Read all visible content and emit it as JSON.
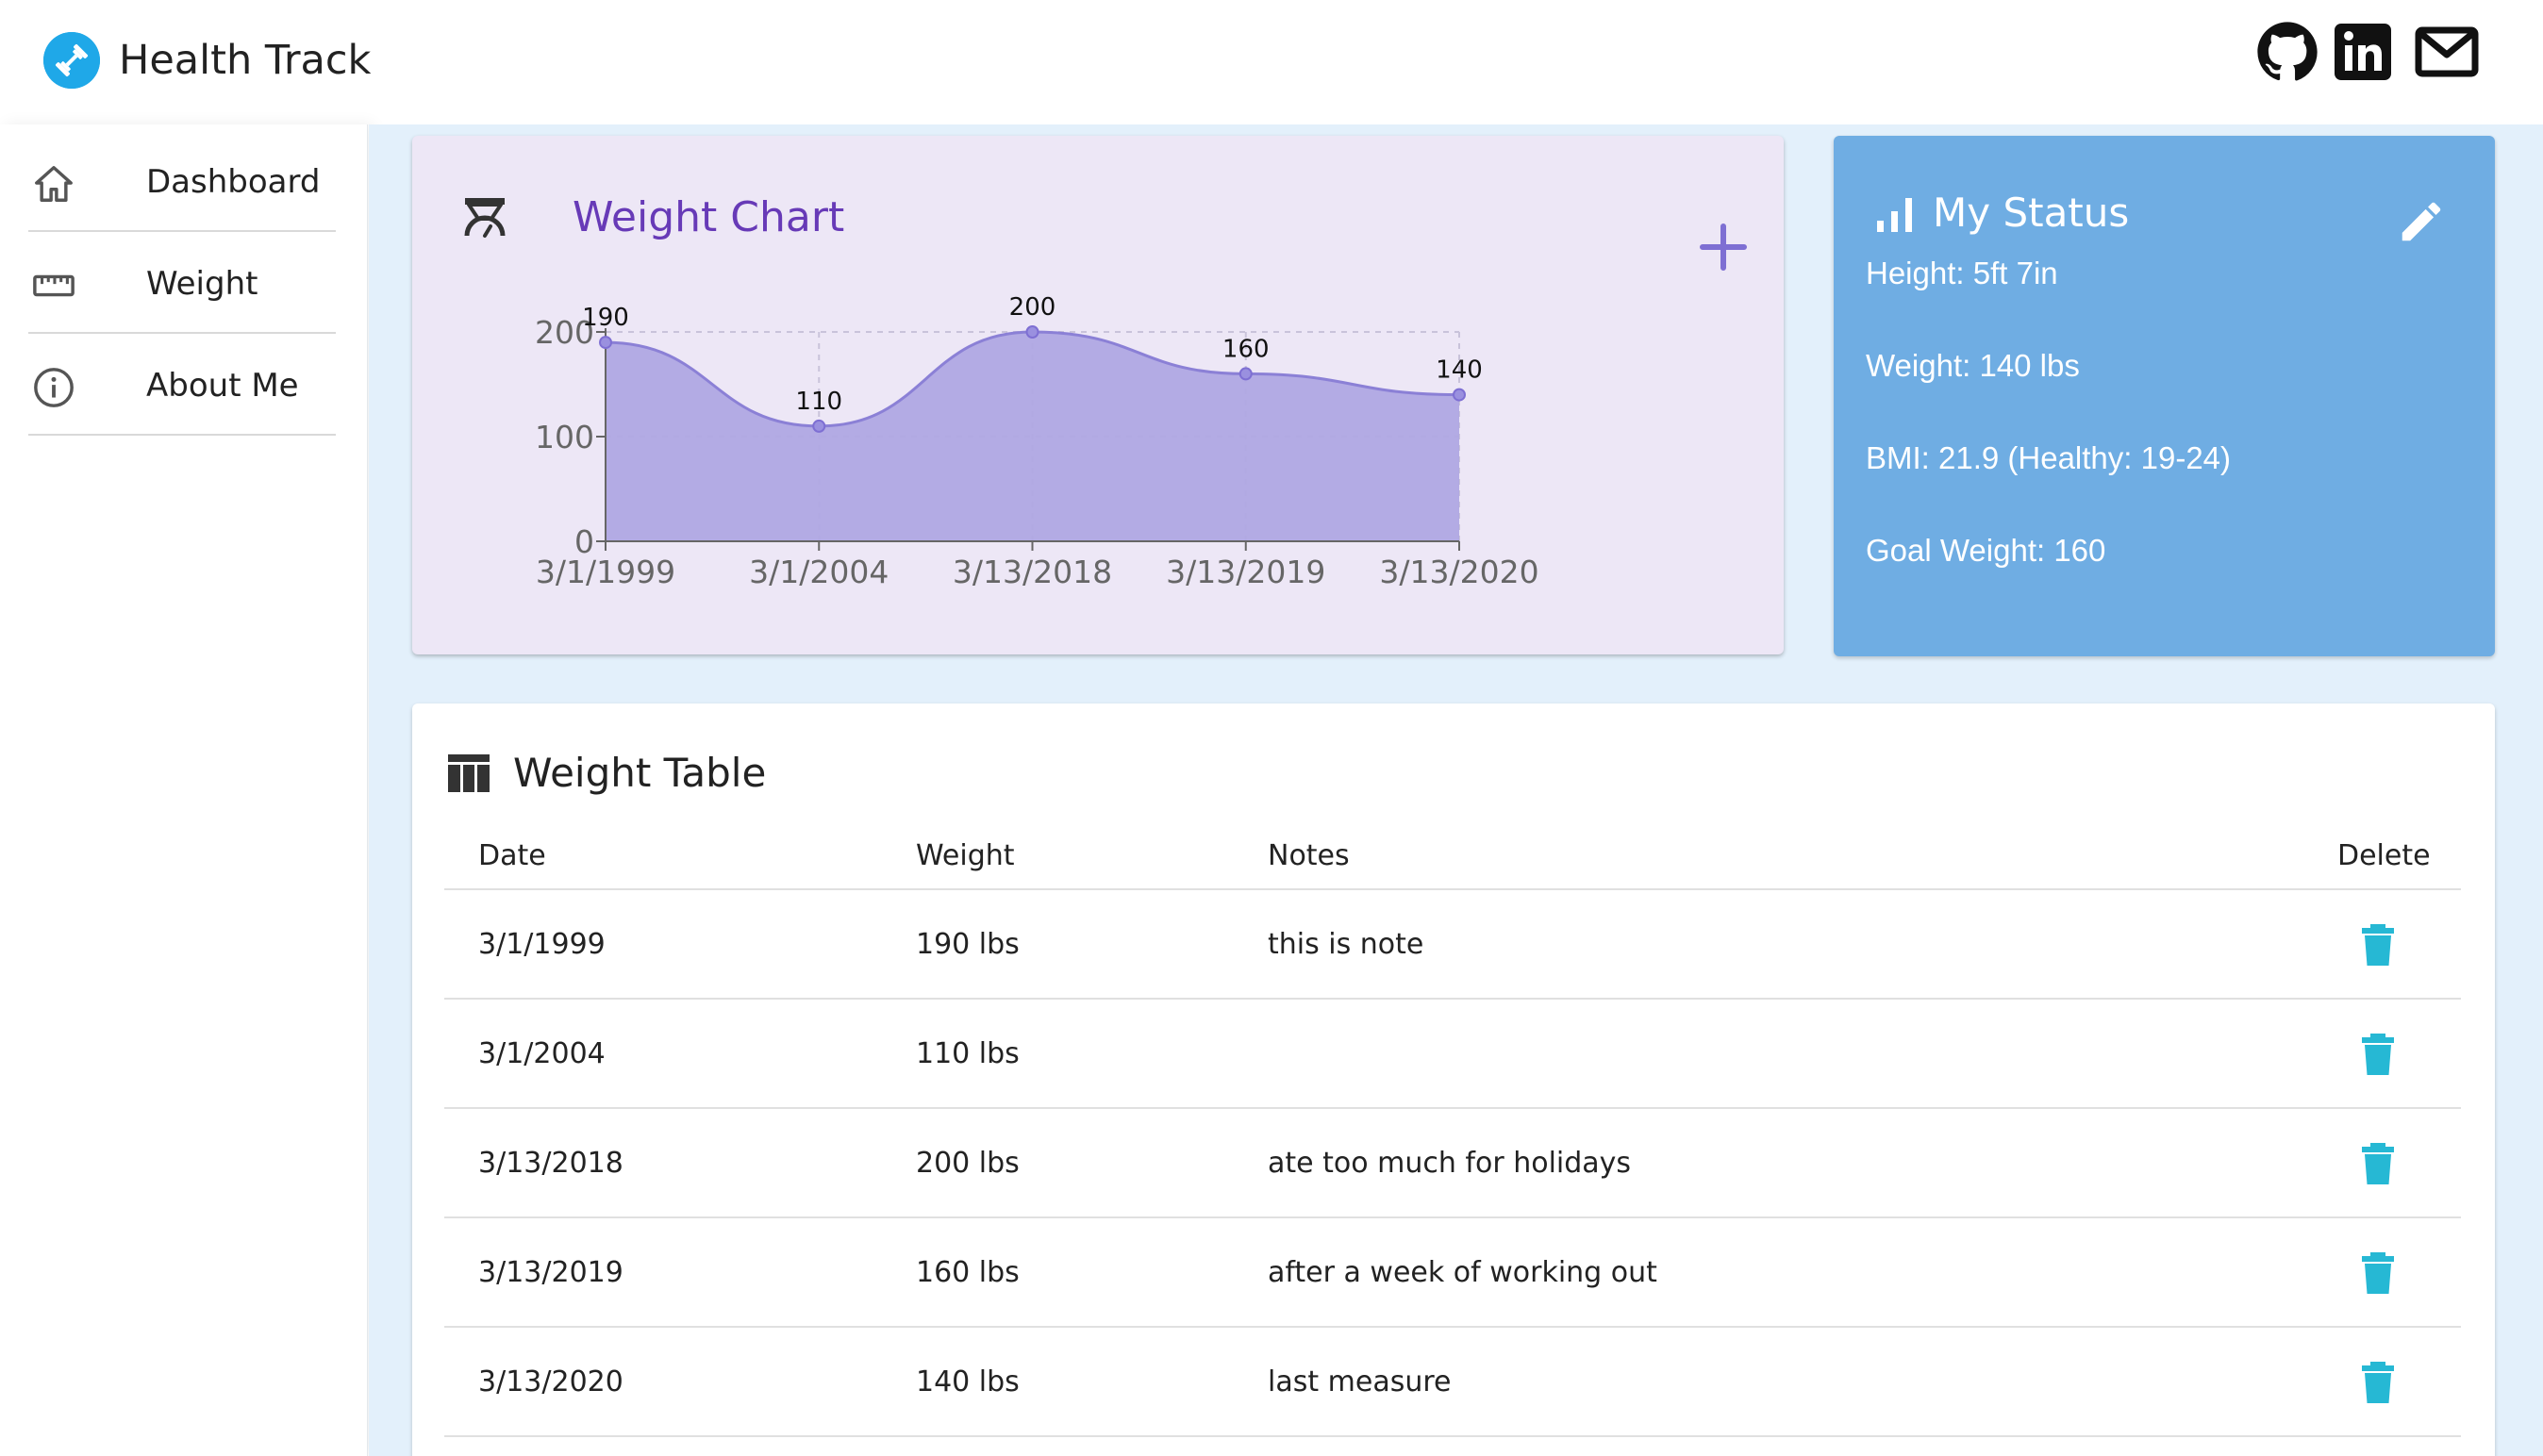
{
  "app": {
    "title": "Health Track",
    "accent": "#1fa8e8"
  },
  "social": [
    {
      "name": "github-icon"
    },
    {
      "name": "linkedin-icon"
    },
    {
      "name": "mail-icon"
    }
  ],
  "sidebar": {
    "items": [
      {
        "label": "Dashboard",
        "icon": "home-icon"
      },
      {
        "label": "Weight",
        "icon": "ruler-icon"
      },
      {
        "label": "About Me",
        "icon": "info-icon"
      }
    ]
  },
  "weight_chart": {
    "title": "Weight Chart",
    "fill_color": "#b0a8e3",
    "stroke_color": "#8b80d6"
  },
  "chart_data": {
    "type": "area",
    "title": "",
    "categories": [
      "3/1/1999",
      "3/1/2004",
      "3/13/2018",
      "3/13/2019",
      "3/13/2020"
    ],
    "values": [
      190,
      110,
      200,
      160,
      140
    ],
    "yticks": [
      0,
      100,
      200
    ],
    "ylim": [
      0,
      200
    ],
    "xlabel": "",
    "ylabel": "",
    "data_labels": [
      "190",
      "110",
      "200",
      "160",
      "140"
    ],
    "grid": true
  },
  "status": {
    "title": "My Status",
    "height": "Height: 5ft 7in",
    "weight": "Weight: 140 lbs",
    "bmi": "BMI: 21.9 (Healthy: 19-24)",
    "goal": "Goal Weight: 160",
    "bg_color": "#6fade3"
  },
  "table": {
    "title": "Weight Table",
    "headers": {
      "date": "Date",
      "weight": "Weight",
      "notes": "Notes",
      "delete": "Delete"
    },
    "rows": [
      {
        "date": "3/1/1999",
        "weight": "190 lbs",
        "notes": "this is note"
      },
      {
        "date": "3/1/2004",
        "weight": "110 lbs",
        "notes": ""
      },
      {
        "date": "3/13/2018",
        "weight": "200 lbs",
        "notes": "ate too much for holidays"
      },
      {
        "date": "3/13/2019",
        "weight": "160 lbs",
        "notes": "after a week of working out"
      },
      {
        "date": "3/13/2020",
        "weight": "140 lbs",
        "notes": "last measure"
      }
    ],
    "delete_color": "#26b8d4"
  }
}
